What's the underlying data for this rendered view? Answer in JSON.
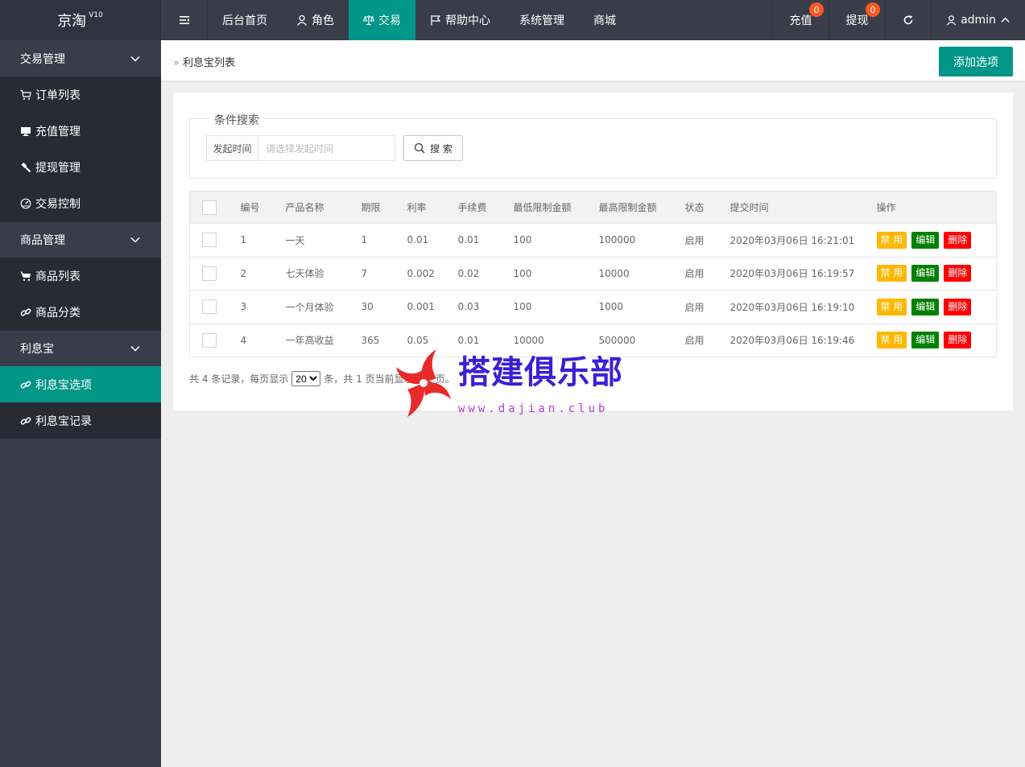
{
  "app": {
    "logo": "京淘",
    "version": "V10"
  },
  "topnav": {
    "items": [
      {
        "label": "后台首页",
        "icon": "home"
      },
      {
        "label": "角色",
        "icon": "user-icon"
      },
      {
        "label": "交易",
        "icon": "scale-icon",
        "active": true
      },
      {
        "label": "帮助中心",
        "icon": "flag-icon"
      },
      {
        "label": "系统管理",
        "icon": ""
      },
      {
        "label": "商城",
        "icon": ""
      }
    ],
    "right": {
      "recharge_label": "充值",
      "recharge_badge": "0",
      "withdraw_label": "提现",
      "withdraw_badge": "0",
      "user_label": "admin"
    }
  },
  "sidebar": {
    "groups": [
      {
        "label": "交易管理",
        "items": [
          "订单列表",
          "充值管理",
          "提现管理",
          "交易控制"
        ]
      },
      {
        "label": "商品管理",
        "items": [
          "商品列表",
          "商品分类"
        ]
      },
      {
        "label": "利息宝",
        "items": [
          "利息宝选项",
          "利息宝记录"
        ]
      }
    ]
  },
  "header": {
    "breadcrumb": "利息宝列表",
    "add_button": "添加选项"
  },
  "search": {
    "legend": "条件搜索",
    "label": "发起时间",
    "placeholder": "请选择发起时间",
    "button": "搜 索"
  },
  "table": {
    "columns": [
      "编号",
      "产品名称",
      "期限",
      "利率",
      "手续费",
      "最低限制金额",
      "最高限制金额",
      "状态",
      "提交时间",
      "操作"
    ],
    "rows": [
      [
        "1",
        "一天",
        "1",
        "0.01",
        "0.01",
        "100",
        "100000",
        "启用",
        "2020年03月06日 16:21:01"
      ],
      [
        "2",
        "七天体验",
        "7",
        "0.002",
        "0.02",
        "100",
        "10000",
        "启用",
        "2020年03月06日 16:19:57"
      ],
      [
        "3",
        "一个月体验",
        "30",
        "0.001",
        "0.03",
        "100",
        "1000",
        "启用",
        "2020年03月06日 16:19:10"
      ],
      [
        "4",
        "一年高收益",
        "365",
        "0.05",
        "0.01",
        "10000",
        "500000",
        "启用",
        "2020年03月06日 16:19:46"
      ]
    ],
    "actions": {
      "disable": "禁 用",
      "edit": "编辑",
      "delete": "删除"
    }
  },
  "pager": {
    "prefix": "共 4 条记录，每页显示",
    "page_size": "20",
    "suffix": "条，共 1 页当前显示第 1 页。"
  },
  "watermark": {
    "text": "搭建俱乐部",
    "url": "www.dajian.club"
  },
  "colors": {
    "accent": "#009688",
    "topbar": "#393d49",
    "sidebar_item": "#282b33",
    "warn": "#ffb800",
    "edit": "#008000",
    "danger": "#ff0000",
    "badge": "#ff5722"
  }
}
